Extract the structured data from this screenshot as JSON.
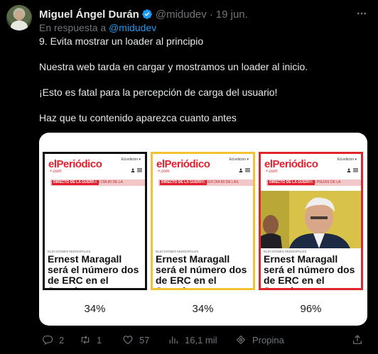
{
  "author": {
    "name": "Miguel Ángel Durán",
    "handle": "@midudev",
    "separator": "·",
    "date": "19 jun."
  },
  "reply": {
    "prefix": "En respuesta a",
    "mention": "@midudev"
  },
  "body": {
    "line1": "9. Evita mostrar un loader al principio",
    "line2": "Nuestra web tarda en cargar y mostramos un loader al inicio.",
    "line3": "¡Esto es fatal para la percepción de carga del usuario!",
    "line4": "Haz que tu contenido aparezca cuanto antes"
  },
  "media": {
    "frames": [
      {
        "border_color": "#111111",
        "logo": "elPeriódico",
        "logo_sub": "+.com",
        "edition": "Ed.edición ▾",
        "banner_tag": "DIRECTO DE LA GUERRA",
        "banner_rest": "1ER DÍA 80 DE LA",
        "kicker": "ELECCIONES MUNICIPALES",
        "headline": "Ernest Maragall será el número dos de ERC en el Senado",
        "percent": "34%",
        "has_photo": false
      },
      {
        "border_color": "#f2c230",
        "logo": "elPeriódico",
        "logo_sub": "+.com",
        "edition": "Ed.edición ▾",
        "banner_tag": "DIRECTO DE LA GUERRA",
        "banner_rest": "LA 1ER DÍA 80 DE LAS",
        "kicker": "ELECCIONES MUNICIPALES",
        "headline": "Ernest Maragall será el número dos de ERC en el Senado",
        "percent": "34%",
        "has_photo": false
      },
      {
        "border_color": "#e0262b",
        "logo": "elPeriódico",
        "logo_sub": "+.com",
        "edition": "Ed.edición ▾",
        "banner_tag": "DIRECTO DE LA GUERRA",
        "banner_rest": "LAS PIEZAS DE LA",
        "kicker": "ELECCIONES MUNICIPALES",
        "headline": "Ernest Maragall será el número dos de ERC en el Senado",
        "percent": "96%",
        "has_photo": true
      }
    ]
  },
  "actions": {
    "replies": "2",
    "retweets": "1",
    "likes": "57",
    "views": "16,1 mil",
    "tip": "Propina"
  },
  "colors": {
    "accent": "#1d9bf0",
    "muted": "#71767b",
    "brand_red": "#e5202e"
  },
  "icons": [
    "verified-badge-icon",
    "more-icon",
    "reply-icon",
    "retweet-icon",
    "like-icon",
    "views-icon",
    "tip-icon",
    "user-icon",
    "menu-icon"
  ]
}
